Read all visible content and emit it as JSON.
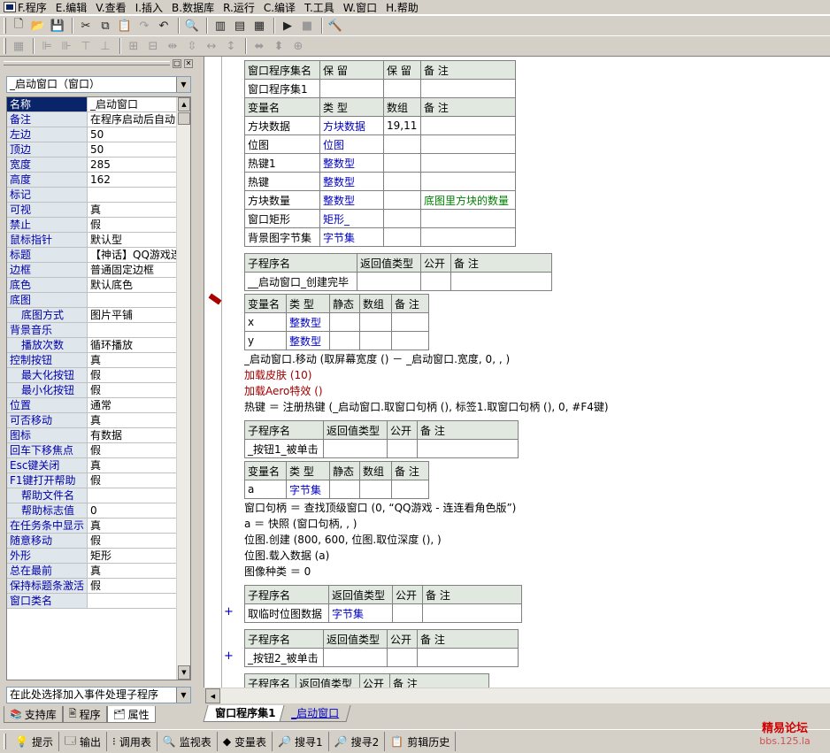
{
  "menu": {
    "items": [
      "F.程序",
      "E.编辑",
      "V.查看",
      "I.插入",
      "B.数据库",
      "R.运行",
      "C.编译",
      "T.工具",
      "W.窗口",
      "H.帮助"
    ]
  },
  "left_panel": {
    "object_select": "_启动窗口（窗口）",
    "event_select": "在此处选择加入事件处理子程序",
    "properties": [
      {
        "name": "名称",
        "value": "_启动窗口",
        "sub": false,
        "selected": true
      },
      {
        "name": "备注",
        "value": "在程序启动后自动",
        "sub": false
      },
      {
        "name": "左边",
        "value": "50",
        "sub": false
      },
      {
        "name": "顶边",
        "value": "50",
        "sub": false
      },
      {
        "name": "宽度",
        "value": "285",
        "sub": false
      },
      {
        "name": "高度",
        "value": "162",
        "sub": false
      },
      {
        "name": "标记",
        "value": "",
        "sub": false
      },
      {
        "name": "可视",
        "value": "真",
        "sub": false
      },
      {
        "name": "禁止",
        "value": "假",
        "sub": false
      },
      {
        "name": "鼠标指针",
        "value": "默认型",
        "sub": false
      },
      {
        "name": "标题",
        "value": "【神话】QQ游戏连",
        "sub": false
      },
      {
        "name": "边框",
        "value": "普通固定边框",
        "sub": false
      },
      {
        "name": "底色",
        "value": "默认底色",
        "sub": false
      },
      {
        "name": "底图",
        "value": "",
        "sub": false
      },
      {
        "name": "底图方式",
        "value": "图片平铺",
        "sub": true
      },
      {
        "name": "背景音乐",
        "value": "",
        "sub": false
      },
      {
        "name": "播放次数",
        "value": "循环播放",
        "sub": true
      },
      {
        "name": "控制按钮",
        "value": "真",
        "sub": false
      },
      {
        "name": "最大化按钮",
        "value": "假",
        "sub": true
      },
      {
        "name": "最小化按钮",
        "value": "假",
        "sub": true
      },
      {
        "name": "位置",
        "value": "通常",
        "sub": false
      },
      {
        "name": "可否移动",
        "value": "真",
        "sub": false
      },
      {
        "name": "图标",
        "value": "有数据",
        "sub": false
      },
      {
        "name": "回车下移焦点",
        "value": "假",
        "sub": false
      },
      {
        "name": "Esc键关闭",
        "value": "真",
        "sub": false
      },
      {
        "name": "F1键打开帮助",
        "value": "假",
        "sub": false
      },
      {
        "name": "帮助文件名",
        "value": "",
        "sub": true
      },
      {
        "name": "帮助标志值",
        "value": "0",
        "sub": true
      },
      {
        "name": "在任务条中显示",
        "value": "真",
        "sub": false
      },
      {
        "name": "随意移动",
        "value": "假",
        "sub": false
      },
      {
        "name": "外形",
        "value": "矩形",
        "sub": false
      },
      {
        "name": "总在最前",
        "value": "真",
        "sub": false
      },
      {
        "name": "保持标题条激活",
        "value": "假",
        "sub": false
      },
      {
        "name": "窗口类名",
        "value": "",
        "sub": false
      }
    ],
    "tabs": [
      "支持库",
      "程序",
      "属性"
    ]
  },
  "code": {
    "assembly_table": {
      "headers": [
        "窗口程序集名",
        "保 留",
        "保 留",
        "备 注"
      ],
      "name": "窗口程序集1",
      "var_headers": [
        "变量名",
        "类 型",
        "数组",
        "备 注"
      ],
      "vars": [
        [
          "方块数据",
          "方块数据",
          "19,11",
          ""
        ],
        [
          "位图",
          "位图",
          "",
          ""
        ],
        [
          "热键1",
          "整数型",
          "",
          ""
        ],
        [
          "热键",
          "整数型",
          "",
          ""
        ],
        [
          "方块数量",
          "整数型",
          "",
          "底图里方块的数量"
        ],
        [
          "窗口矩形",
          "矩形_",
          "",
          ""
        ],
        [
          "背景图字节集",
          "字节集",
          "",
          ""
        ]
      ]
    },
    "sub_headers": [
      "子程序名",
      "返回值类型",
      "公开",
      "备 注"
    ],
    "local_headers": [
      "变量名",
      "类 型",
      "静态",
      "数组",
      "备 注"
    ],
    "sub1": {
      "name": "__启动窗口_创建完毕",
      "vars": [
        [
          "x",
          "整数型"
        ],
        [
          "y",
          "整数型"
        ]
      ],
      "lines": [
        "_启动窗口.移动 (取屏幕宽度 () － _启动窗口.宽度, 0, , )",
        "加载皮肤 (10)",
        "加载Aero特效 ()",
        "热键 ＝ 注册热键 (_启动窗口.取窗口句柄 (), 标签1.取窗口句柄 (), 0, #F4键)"
      ]
    },
    "sub2": {
      "name": "_按钮1_被单击",
      "vars": [
        [
          "a",
          "字节集"
        ]
      ],
      "lines": [
        "窗口句柄 ＝ 查找顶级窗口 (0, “QQ游戏 - 连连看角色版”)",
        "a ＝ 快照 (窗口句柄, , )",
        "位图.创建 (800, 600, 位图.取位深度 (), )",
        "位图.载入数据 (a)",
        "图像种类 ＝ 0"
      ]
    },
    "sub3": {
      "name": "取临时位图数据",
      "ret": "字节集"
    },
    "sub4": {
      "name": "_按钮2_被单击"
    }
  },
  "code_tabs": [
    "窗口程序集1",
    "_启动窗口"
  ],
  "bottom_tabs": [
    "提示",
    "输出",
    "调用表",
    "监视表",
    "变量表",
    "搜寻1",
    "搜寻2",
    "剪辑历史"
  ],
  "watermark": {
    "line1": "精易论坛",
    "line2": "bbs.125.la"
  }
}
